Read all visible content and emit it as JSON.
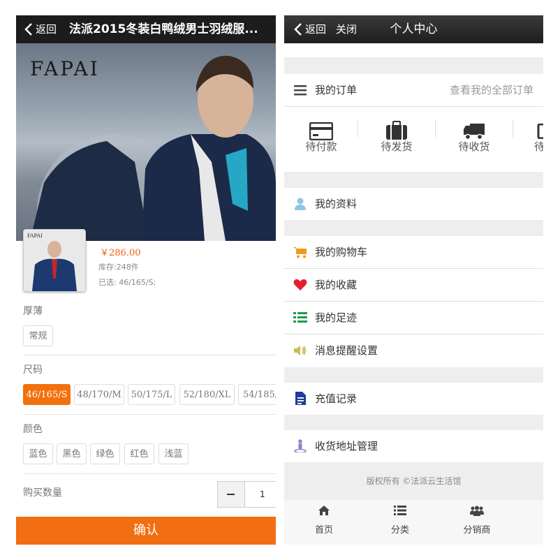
{
  "left": {
    "nav": {
      "back_label": "返回",
      "title": "法派2015冬装白鸭绒男士羽绒服..."
    },
    "hero": {
      "brand": "FAPAI"
    },
    "product": {
      "price": "￥286.00",
      "stock": "库存:248件",
      "selected": "已选: 46/165/S;"
    },
    "sections": {
      "thickness": {
        "label": "厚薄",
        "options": [
          "常规"
        ]
      },
      "size": {
        "label": "尺码",
        "options": [
          "46/165/S",
          "48/170/M",
          "50/175/L",
          "52/180/XL",
          "54/185/"
        ],
        "active": "46/165/S"
      },
      "color": {
        "label": "颜色",
        "options": [
          "蓝色",
          "黑色",
          "绿色",
          "红色",
          "浅蓝"
        ]
      },
      "quantity": {
        "label": "购买数量",
        "value": "1"
      }
    },
    "confirm_label": "确认",
    "accent": "#f26e12"
  },
  "right": {
    "nav": {
      "back_label": "返回",
      "close_label": "关闭",
      "title": "个人中心"
    },
    "orders": {
      "title": "我的订单",
      "view_all": "查看我的全部订单",
      "items": [
        {
          "label": "待付款",
          "icon": "card-icon"
        },
        {
          "label": "待发货",
          "icon": "suitcase-icon"
        },
        {
          "label": "待收货",
          "icon": "truck-icon"
        },
        {
          "label": "待",
          "icon": "review-icon"
        }
      ]
    },
    "menu": {
      "profile": "我的资料",
      "cart": "我的购物车",
      "favorites": "我的收藏",
      "history": "我的足迹",
      "notifications": "消息提醒设置",
      "recharge": "充值记录",
      "address": "收货地址管理"
    },
    "footer": "版权所有 ©法派云生活馆",
    "tabbar": [
      {
        "label": "首页",
        "icon": "home-icon"
      },
      {
        "label": "分类",
        "icon": "list-icon"
      },
      {
        "label": "分销商",
        "icon": "group-icon"
      }
    ]
  }
}
